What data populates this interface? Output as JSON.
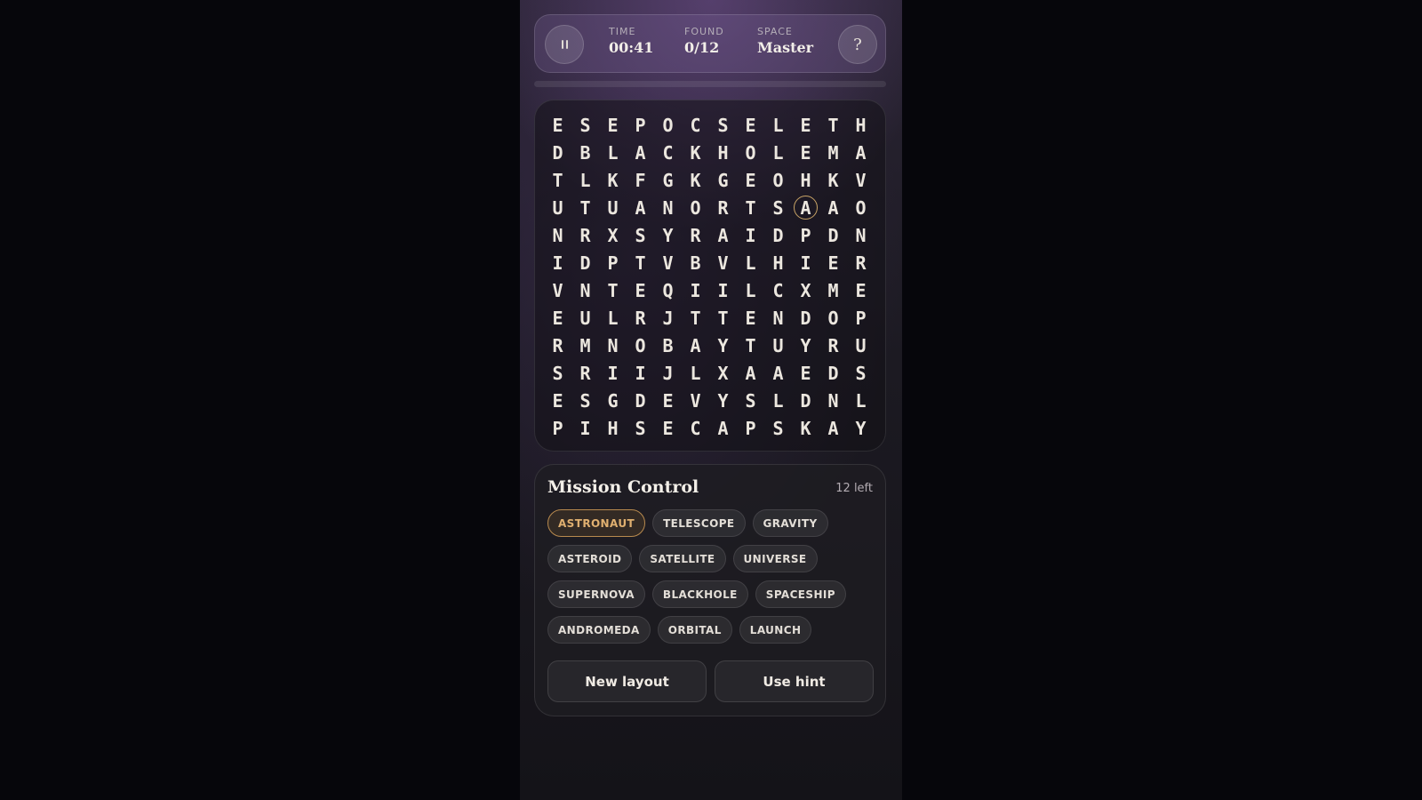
{
  "stats": {
    "time_label": "TIME",
    "time_value": "00:41",
    "found_label": "FOUND",
    "found_value": "0/12",
    "space_label": "SPACE",
    "space_value": "Master"
  },
  "icons": {
    "pause": "pause-icon",
    "help": "help-icon"
  },
  "help_glyph": "?",
  "progress": {
    "fraction": 0
  },
  "accent_color": "#d9a963",
  "grid": {
    "rows": [
      "ESEPOCSELETH",
      "DBLACKHOLEMA",
      "TLKFGKGEOHKV",
      "UTUANORTSAAO",
      "NRXSYRAIDPDN",
      "IDPTVBVLHIER",
      "VNTEQIILCXME",
      "EULRJTTENDOP",
      "RMNOBAYTUYRU",
      "SRIIJLXAAEDS",
      "ESGDEVYSLDNL",
      "PIHSECAPSKAY"
    ],
    "hint_cell": {
      "row": 3,
      "col": 9
    }
  },
  "words_panel": {
    "title": "Mission Control",
    "remaining": "12 left",
    "rows": [
      [
        "ASTRONAUT",
        "TELESCOPE",
        "GRAVITY"
      ],
      [
        "ASTEROID",
        "SATELLITE",
        "UNIVERSE"
      ],
      [
        "SUPERNOVA",
        "BLACKHOLE",
        "SPACESHIP"
      ],
      [
        "ANDROMEDA",
        "ORBITAL",
        "LAUNCH"
      ]
    ],
    "active_word": "ASTRONAUT"
  },
  "actions": {
    "new_layout": "New layout",
    "use_hint": "Use hint"
  }
}
